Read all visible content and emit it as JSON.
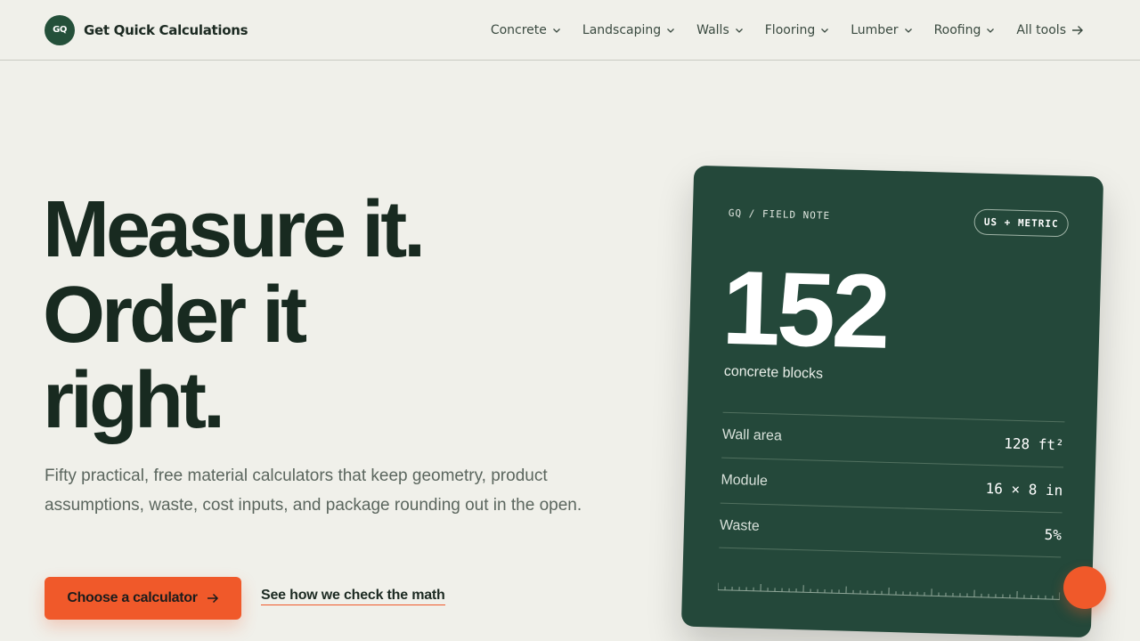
{
  "brand": {
    "logo_text": "GQ",
    "name": "Get Quick Calculations"
  },
  "nav": {
    "items": [
      {
        "label": "Concrete"
      },
      {
        "label": "Landscaping"
      },
      {
        "label": "Walls"
      },
      {
        "label": "Flooring"
      },
      {
        "label": "Lumber"
      },
      {
        "label": "Roofing"
      }
    ],
    "all_tools": "All tools"
  },
  "hero": {
    "headline": [
      "Measure it.",
      "Order it",
      "right."
    ],
    "subtext": "Fifty practical, free material calculators that keep geometry, product assumptions, waste, cost inputs, and package rounding out in the open.",
    "cta_label": "Choose a calculator",
    "secondary_label": "See how we check the math"
  },
  "card": {
    "label": "GQ / FIELD NOTE",
    "badge": "US + METRIC",
    "result_value": "152",
    "result_unit": "concrete blocks",
    "rows": [
      {
        "label": "Wall area",
        "value": "128 ft²"
      },
      {
        "label": "Module",
        "value": "16 × 8 in"
      },
      {
        "label": "Waste",
        "value": "5%"
      }
    ]
  },
  "colors": {
    "accent": "#f0592a",
    "brand_green": "#24503a",
    "card_green": "#24483a",
    "background": "#f0f0ea"
  },
  "icons": {
    "logo": "gq-logo",
    "nav_chevron": "chevron-down-icon",
    "all_tools_arrow": "arrow-right-icon",
    "cta_arrow": "arrow-right-icon"
  }
}
